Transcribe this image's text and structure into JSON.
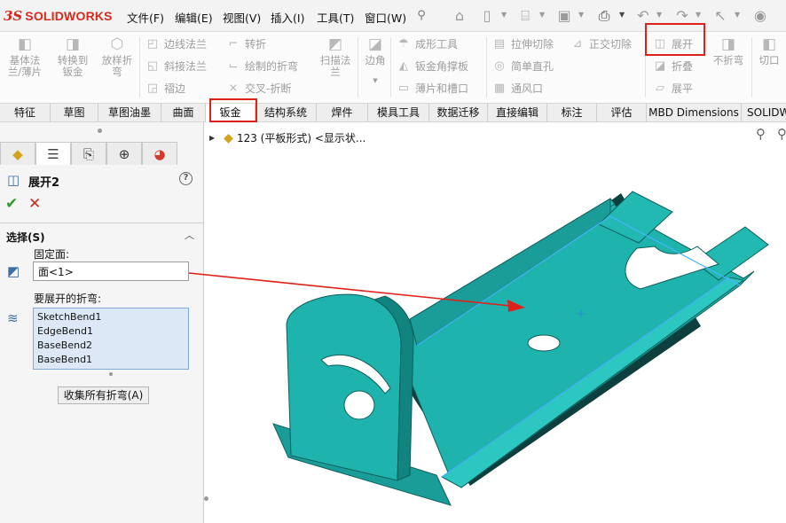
{
  "app": {
    "brand": "SOLIDWORKS",
    "brand_mark": "3S"
  },
  "menu": [
    "文件(F)",
    "编辑(E)",
    "视图(V)",
    "插入(I)",
    "工具(T)",
    "窗口(W)"
  ],
  "ribbon": {
    "big_buttons": [
      {
        "label": "基体法\n兰/薄片",
        "icon": "base-flange-icon"
      },
      {
        "label": "转换到\n钣金",
        "icon": "convert-to-sheet-metal-icon"
      },
      {
        "label": "放样折\n弯",
        "icon": "lofted-bend-icon"
      },
      {
        "label": "扫描法\n兰",
        "icon": "swept-flange-icon"
      },
      {
        "label": "边角",
        "icon": "corners-icon"
      },
      {
        "label": "展开",
        "icon": "unfold-icon"
      },
      {
        "label": "不折弯",
        "icon": "no-bends-icon"
      },
      {
        "label": "切口",
        "icon": "rip-icon"
      }
    ],
    "small_buttons": [
      {
        "label": "边线法兰",
        "icon": "edge-flange-icon"
      },
      {
        "label": "斜接法兰",
        "icon": "miter-flange-icon"
      },
      {
        "label": "褶边",
        "icon": "hem-icon"
      },
      {
        "label": "转折",
        "icon": "jog-icon"
      },
      {
        "label": "绘制的折弯",
        "icon": "sketched-bend-icon"
      },
      {
        "label": "交叉-折断",
        "icon": "cross-break-icon"
      },
      {
        "label": "成形工具",
        "icon": "forming-tool-icon"
      },
      {
        "label": "钣金角撑板",
        "icon": "gusset-icon"
      },
      {
        "label": "薄片和槽口",
        "icon": "tab-slot-icon"
      },
      {
        "label": "拉伸切除",
        "icon": "extruded-cut-icon"
      },
      {
        "label": "简单直孔",
        "icon": "simple-hole-icon"
      },
      {
        "label": "通风口",
        "icon": "vent-icon"
      },
      {
        "label": "正交切除",
        "icon": "normal-cut-icon"
      },
      {
        "label": "折叠",
        "icon": "fold-icon"
      },
      {
        "label": "展平",
        "icon": "flatten-icon"
      }
    ]
  },
  "tabs": [
    "特征",
    "草图",
    "草图油墨",
    "曲面",
    "钣金",
    "结构系统",
    "焊件",
    "模具工具",
    "数据迁移",
    "直接编辑",
    "标注",
    "评估",
    "MBD Dimensions",
    "SOLIDW"
  ],
  "active_tab": "钣金",
  "property_manager": {
    "title": "展开2",
    "help": "?",
    "ok_symbol": "✔",
    "cancel_symbol": "✕",
    "section_title": "选择(S)",
    "fixed_face_label": "固定面:",
    "fixed_face_value": "面<1>",
    "bends_label": "要展开的折弯:",
    "bends": [
      "SketchBend1",
      "EdgeBend1",
      "BaseBend2",
      "BaseBend1"
    ],
    "collect_button": "收集所有折弯(A)"
  },
  "viewport": {
    "tree_label": "123 (平板形式) <显示状..."
  },
  "colors": {
    "highlight": "#e0201a",
    "part_face": "#1fb3ad",
    "part_edge": "#0f5e5b",
    "selection_edge": "#45b6ff"
  }
}
